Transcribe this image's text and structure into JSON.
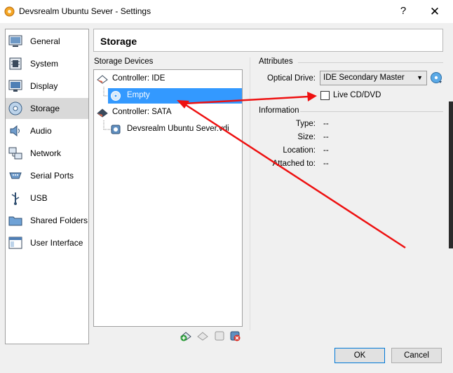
{
  "window": {
    "title": "Devsrealm Ubuntu Sever - Settings",
    "help_label": "?",
    "close_label": "✕"
  },
  "sidebar": {
    "items": [
      {
        "label": "General",
        "icon": "general-icon"
      },
      {
        "label": "System",
        "icon": "system-icon"
      },
      {
        "label": "Display",
        "icon": "display-icon"
      },
      {
        "label": "Storage",
        "icon": "storage-icon",
        "selected": true
      },
      {
        "label": "Audio",
        "icon": "audio-icon"
      },
      {
        "label": "Network",
        "icon": "network-icon"
      },
      {
        "label": "Serial Ports",
        "icon": "serial-ports-icon"
      },
      {
        "label": "USB",
        "icon": "usb-icon"
      },
      {
        "label": "Shared Folders",
        "icon": "shared-folders-icon"
      },
      {
        "label": "User Interface",
        "icon": "user-interface-icon"
      }
    ]
  },
  "page": {
    "title": "Storage"
  },
  "storage_devices": {
    "heading": "Storage Devices",
    "tree": [
      {
        "label": "Controller: IDE",
        "type": "controller"
      },
      {
        "label": "Empty",
        "type": "optical",
        "selected": true
      },
      {
        "label": "Controller: SATA",
        "type": "controller"
      },
      {
        "label": "Devsrealm Ubuntu Sever.vdi",
        "type": "disk"
      }
    ]
  },
  "attributes": {
    "heading": "Attributes",
    "optical_drive_label": "Optical Drive:",
    "optical_drive_value": "IDE Secondary Master",
    "live_cd_label": "Live CD/DVD",
    "live_cd_checked": false
  },
  "information": {
    "heading": "Information",
    "rows": [
      {
        "label": "Type:",
        "value": "--"
      },
      {
        "label": "Size:",
        "value": "--"
      },
      {
        "label": "Location:",
        "value": "--"
      },
      {
        "label": "Attached to:",
        "value": "--"
      }
    ]
  },
  "buttons": {
    "ok": "OK",
    "cancel": "Cancel"
  },
  "colors": {
    "selection": "#3399ff",
    "annotation_arrow": "#ee1111"
  }
}
